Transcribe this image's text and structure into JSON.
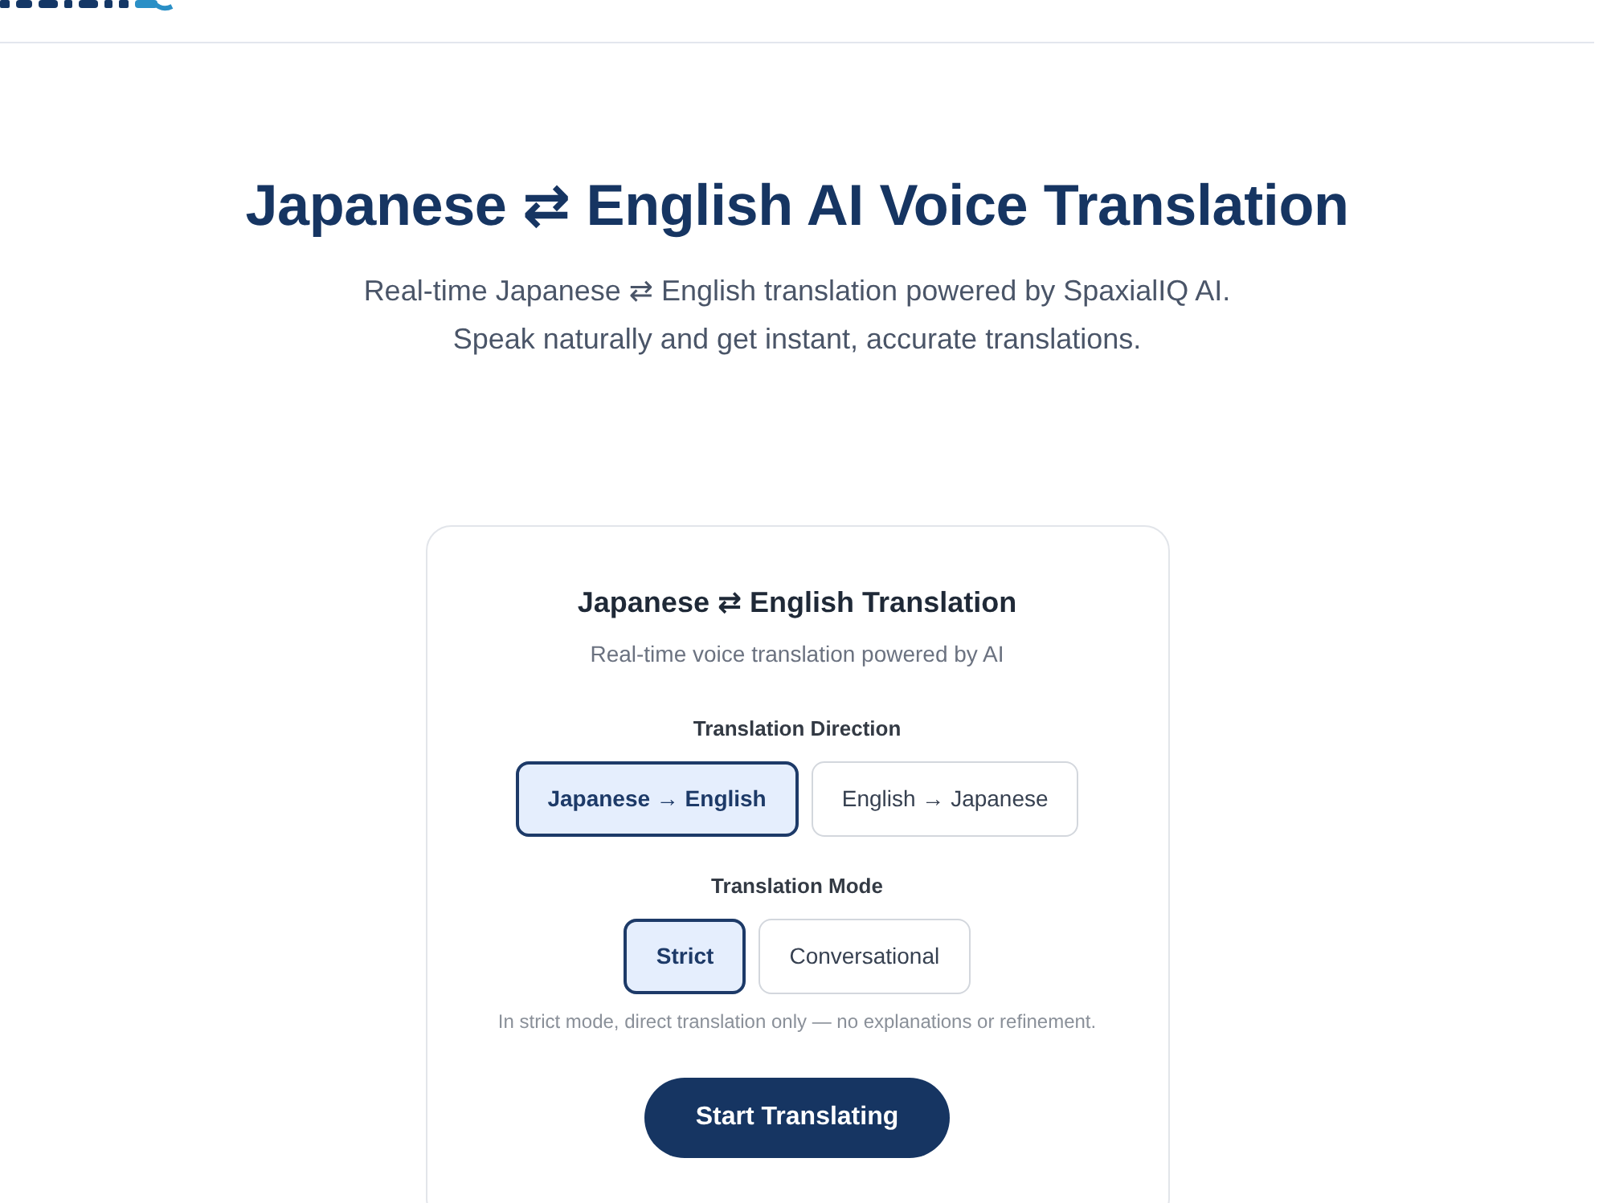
{
  "hero": {
    "title": "Japanese ⇄ English AI Voice Translation",
    "subtitle_lines": [
      "Real-time Japanese ⇄ English translation powered by SpaxialIQ AI.",
      "Speak naturally and get instant, accurate translations."
    ]
  },
  "card": {
    "title": "Japanese ⇄ English Translation",
    "subtitle": "Real-time voice translation powered by AI",
    "groups": [
      {
        "label": "Translation Direction",
        "options": [
          {
            "label": "Japanese → English",
            "selected": true
          },
          {
            "label": "English → Japanese",
            "selected": false
          }
        ]
      },
      {
        "label": "Translation Mode",
        "options": [
          {
            "label": "Strict",
            "selected": true
          },
          {
            "label": "Conversational",
            "selected": false
          }
        ],
        "note": "In strict mode, direct translation only — no explanations or refinement."
      }
    ],
    "button": "Start Translating"
  }
}
